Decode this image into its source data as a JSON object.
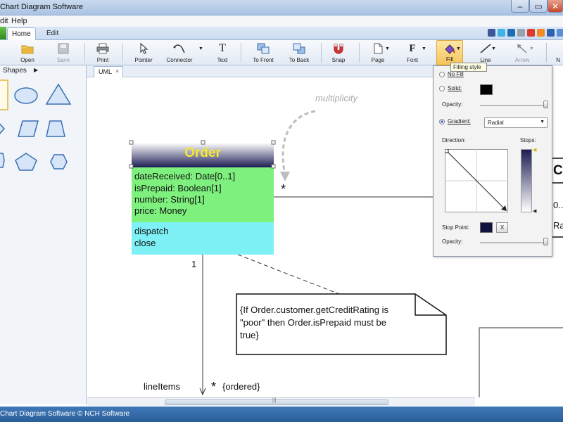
{
  "window": {
    "title": "Chart Diagram Software"
  },
  "menu": {
    "items": [
      "dit",
      "Help"
    ]
  },
  "ribbon_tabs": [
    {
      "label": "Home"
    },
    {
      "label": "Edit"
    }
  ],
  "toolbar": {
    "open": "Open",
    "save": "Save",
    "print": "Print",
    "pointer": "Pointer",
    "connector": "Connector",
    "text": "Text",
    "to_front": "To Front",
    "to_back": "To Back",
    "snap": "Snap",
    "page": "Page",
    "font": "Font",
    "fill": "Fill",
    "line": "Line",
    "arrow": "Arrow",
    "more": "N"
  },
  "tooltip": "Filling style",
  "left_panel": {
    "header": "Shapes"
  },
  "doc_tab": {
    "label": "UML",
    "close": "×"
  },
  "fill_popup": {
    "no_fill": "No Fill",
    "solid": "Solid:",
    "opacity": "Opacity:",
    "gradient": "Gradient:",
    "gradient_type": "Radial",
    "direction": "Direction:",
    "stops": "Stops:",
    "stop_point": "Stop Point:",
    "remove_stop": "X",
    "opacity2": "Opacity:"
  },
  "diagram": {
    "multiplicity_note": "multiplicity",
    "class_title": "Order",
    "attributes": [
      "dateReceived: Date[0..1]",
      "isPrepaid: Boolean[1]",
      "number: String[1]",
      "price: Money"
    ],
    "operations": [
      "dispatch",
      "close"
    ],
    "star_top": "*",
    "one": "1",
    "constraint": [
      "{If Order.customer.getCreditRating is",
      "\"poor\" then Order.isPrepaid must be",
      "true}"
    ],
    "line_items": "lineItems",
    "star_bottom": "*",
    "ordered": "{ordered}",
    "partial_cu": "Cu",
    "partial_0": "0..",
    "partial_ra": "Ra"
  },
  "status_bar": {
    "text": "Chart Diagram Software © NCH Software"
  },
  "colors": {
    "header_grad_top": "#ffffff",
    "header_grad_bottom": "#1d1d55",
    "attr_bg": "#7ef07e",
    "ops_bg": "#7ef1f7",
    "title_text": "#f5e830",
    "statusbar": "#2f6aa8"
  }
}
